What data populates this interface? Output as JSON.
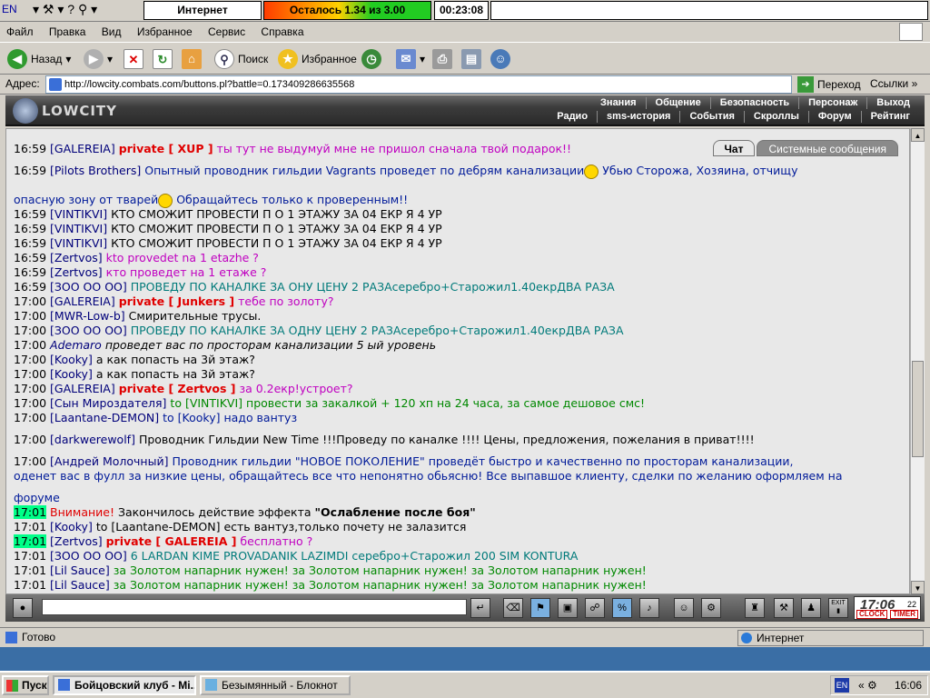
{
  "topbar": {
    "lang": "EN",
    "internet": "Интернет",
    "limit_text": "Осталось 1.34 из 3.00",
    "limit_fraction": 0.447,
    "session_timer": "00:23:08"
  },
  "menu": [
    "Файл",
    "Правка",
    "Вид",
    "Избранное",
    "Сервис",
    "Справка"
  ],
  "toolbar": {
    "back": "Назад",
    "search": "Поиск",
    "favorites": "Избранное"
  },
  "address": {
    "label": "Адрес:",
    "url": "http://lowcity.combats.com/buttons.pl?battle=0.173409286635568",
    "go": "Переход",
    "links": "Ссылки"
  },
  "game": {
    "logo": "LOWCITY",
    "nav_top": [
      "Знания",
      "Общение",
      "Безопасность",
      "Персонаж",
      "Выход"
    ],
    "nav_bottom": [
      "Радио",
      "sms-история",
      "События",
      "Скроллы",
      "Форум",
      "Рейтинг"
    ]
  },
  "chat_tabs": [
    "Чат",
    "Системные сообщения"
  ],
  "chat": [
    {
      "time": "16:59",
      "name": "[GALEREIA]",
      "private": "private [ XUP ]",
      "text": " ты тут не выдумуй мне не пришол сначала твой подарок!!",
      "cls": "pink"
    },
    {
      "time": "16:59",
      "name": "[Pilots Brothers]",
      "text": " Опытный проводник гильдии Vagrants проведет по дебрям канализации",
      "text2": " Убью Сторожа, Хозяина, отчищу",
      "cls": "blue"
    },
    {
      "text": "опасную зону от тварей",
      "text2": " Обращайтесь только к проверенным!!",
      "cls": "blue"
    },
    {
      "time": "16:59",
      "name": "[VINTIKVI]",
      "text": " КТО СМОЖИТ ПРОВЕСТИ П О 1 ЭТАЖУ ЗА 04 ЕКР Я 4 УР",
      "cls": "t"
    },
    {
      "time": "16:59",
      "name": "[VINTIKVI]",
      "text": " КТО СМОЖИТ ПРОВЕСТИ П О 1 ЭТАЖУ ЗА 04 ЕКР Я 4 УР",
      "cls": "t"
    },
    {
      "time": "16:59",
      "name": "[VINTIKVI]",
      "text": " КТО СМОЖИТ ПРОВЕСТИ П О 1 ЭТАЖУ ЗА 04 ЕКР Я 4 УР",
      "cls": "t"
    },
    {
      "time": "16:59",
      "name": "[Zertvos]",
      "text": " kto provedet na 1 etazhe ?",
      "cls": "pink"
    },
    {
      "time": "16:59",
      "name": "[Zertvos]",
      "text": " кто проведет на 1 етаже ?",
      "cls": "pink"
    },
    {
      "time": "16:59",
      "name": "[ЗОО ОО ОО]",
      "text": " ПРОВЕДУ ПО КАНАЛКЕ ЗА ОНУ ЦЕНУ 2 РАЗАсеребро+Старожил1.40екрДВА РАЗА",
      "cls": "teal"
    },
    {
      "time": "17:00",
      "name": "[GALEREIA]",
      "private": "private [ Junkers ]",
      "text": " тебе по золоту?",
      "cls": "pink"
    },
    {
      "time": "17:00",
      "name": "[MWR-Low-b]",
      "text": " Смирительные трусы.",
      "cls": "t"
    },
    {
      "time": "17:00",
      "name": "[ЗОО ОО ОО]",
      "text": " ПРОВЕДУ ПО КАНАЛКЕ ЗА ОДНУ ЦЕНУ 2 РАЗАсеребро+Старожил1.40екрДВА РАЗА",
      "cls": "teal"
    },
    {
      "time": "17:00",
      "name": "Ademaro",
      "text": " проведет вас по просторам канализации 5 ый уровень",
      "cls": "t",
      "italic": true
    },
    {
      "time": "17:00",
      "name": "[Kooky]",
      "text": " а как попасть на 3й этаж?",
      "cls": "t"
    },
    {
      "time": "17:00",
      "name": "[Kooky]",
      "text": " а как попасть на 3й этаж?",
      "cls": "t"
    },
    {
      "time": "17:00",
      "name": "[GALEREIA]",
      "private": "private [ Zertvos ]",
      "text": " за 0.2екр!устроет?",
      "cls": "pink"
    },
    {
      "time": "17:00",
      "name": "[Сын Мироздателя]",
      "text": " to [VINTIKVI] провести за закалкой + 120 хп на 24 часа, за самое дешовое смс!",
      "cls": "green"
    },
    {
      "time": "17:00",
      "name": "[Laantane-DEMON]",
      "text": " to [Kooky] надо вантуз",
      "cls": "blue"
    },
    {
      "time": "17:00",
      "name": "[darkwerewolf]",
      "text": " Проводник Гильдии New Time !!!Проведу по каналке !!!! Цены, предложения, пожелания в приват!!!!",
      "cls": "t"
    },
    {
      "time": "17:00",
      "name": "[Андрей Молочный]",
      "text": " Проводник гильдии \"НОВОЕ ПОКОЛЕНИЕ\" проведёт быстро и качественно по просторам канализации,",
      "cls": "blue"
    },
    {
      "text": "оденет вас в фулл за низкие цены, обращайтесь все что непонятно обьясню! Все выпавшое клиенту, сделки по желанию оформляем на",
      "cls": "blue"
    },
    {
      "text": "форуме",
      "cls": "blue"
    },
    {
      "time": "17:01",
      "hl": true,
      "warn": "Внимание!",
      "text": " Закончилось действие эффекта ",
      "bold": "\"Ослабление после боя\"",
      "cls": "t"
    },
    {
      "time": "17:01",
      "name": "[Kooky]",
      "text": " to [Laantane-DEMON] есть вантуз,только почету не залазится",
      "cls": "t"
    },
    {
      "time": "17:01",
      "hl": true,
      "name": "[Zertvos]",
      "private": "private [ GALEREIA ]",
      "text": " бесплатно ?",
      "cls": "pink"
    },
    {
      "time": "17:01",
      "name": "[ЗОО ОО ОО]",
      "text": " 6 LARDAN KIME PROVADANIK LAZIMDI серебро+Старожил 200 SIM KONTURA",
      "cls": "teal"
    },
    {
      "time": "17:01",
      "name": "[Lil Sauce]",
      "text": " за Золотом напарник нужен! за Золотом напарник нужен! за Золотом напарник нужен!",
      "cls": "green"
    },
    {
      "time": "17:01",
      "name": "[Lil Sauce]",
      "text": " за Золотом напарник нужен! за Золотом напарник нужен! за Золотом напарник нужен!",
      "cls": "green"
    }
  ],
  "clock": {
    "time": "17:06",
    "sec": "22",
    "label1": "CLOCK",
    "label2": "TIMER",
    "exit": "EXIT"
  },
  "status": {
    "left": "Готово",
    "right": "Интернет"
  },
  "taskbar": {
    "start": "Пуск",
    "tasks": [
      "Бойцовский клуб - Mi...",
      "Безымянный - Блокнот"
    ],
    "tray_lang": "EN",
    "time": "16:06"
  }
}
